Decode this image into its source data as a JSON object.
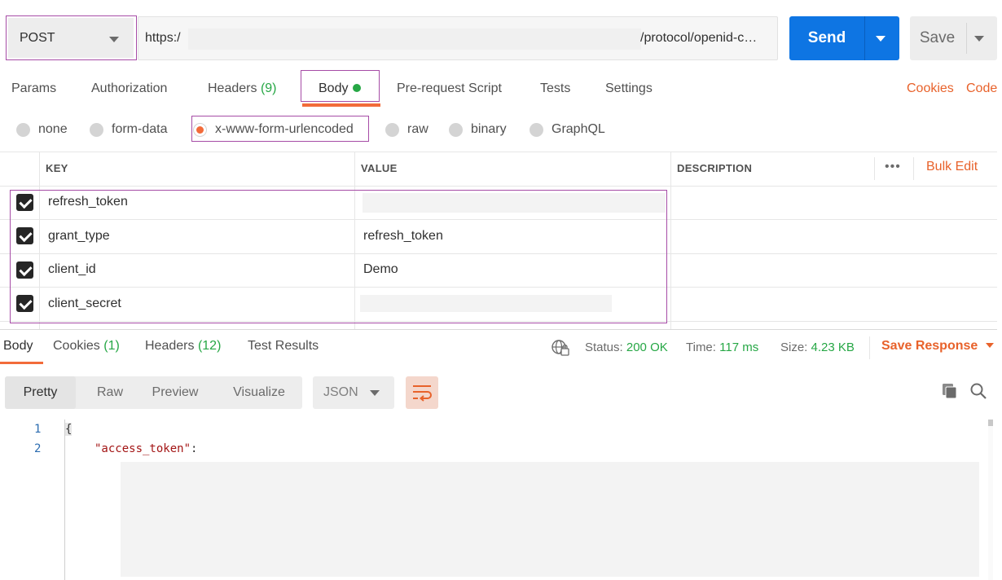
{
  "request": {
    "method": "POST",
    "url_prefix": "https:/",
    "url_suffix": "/protocol/openid-c…",
    "send_label": "Send",
    "save_label": "Save"
  },
  "tabs": [
    {
      "label": "Params"
    },
    {
      "label": "Authorization"
    },
    {
      "label": "Headers",
      "count": "(9)"
    },
    {
      "label": "Body"
    },
    {
      "label": "Pre-request Script"
    },
    {
      "label": "Tests"
    },
    {
      "label": "Settings"
    }
  ],
  "links": {
    "cookies": "Cookies",
    "code": "Code"
  },
  "body_types": [
    {
      "label": "none"
    },
    {
      "label": "form-data"
    },
    {
      "label": "x-www-form-urlencoded",
      "selected": true
    },
    {
      "label": "raw"
    },
    {
      "label": "binary"
    },
    {
      "label": "GraphQL"
    }
  ],
  "table": {
    "headers": {
      "key": "KEY",
      "value": "VALUE",
      "description": "DESCRIPTION"
    },
    "bulk_edit": "Bulk Edit",
    "more": "•••",
    "rows": [
      {
        "checked": true,
        "key": "refresh_token",
        "value": ""
      },
      {
        "checked": true,
        "key": "grant_type",
        "value": "refresh_token"
      },
      {
        "checked": true,
        "key": "client_id",
        "value": "Demo"
      },
      {
        "checked": true,
        "key": "client_secret",
        "value": ""
      }
    ]
  },
  "response": {
    "tabs": [
      {
        "label": "Body"
      },
      {
        "label": "Cookies",
        "count": "(1)"
      },
      {
        "label": "Headers",
        "count": "(12)"
      },
      {
        "label": "Test Results"
      }
    ],
    "status_label": "Status:",
    "status_value": "200 OK",
    "time_label": "Time:",
    "time_value": "117 ms",
    "size_label": "Size:",
    "size_value": "4.23 KB",
    "save_response": "Save Response",
    "view_modes": [
      "Pretty",
      "Raw",
      "Preview",
      "Visualize"
    ],
    "format": "JSON",
    "code": {
      "line_numbers": [
        "1",
        "2"
      ],
      "line1": "{",
      "line2_key": "\"access_token\"",
      "line2_colon": ":"
    }
  },
  "colors": {
    "accent": "#f26b3a",
    "send": "#0e75e3",
    "success": "#26a745",
    "highlight_border": "#a64ca6"
  }
}
